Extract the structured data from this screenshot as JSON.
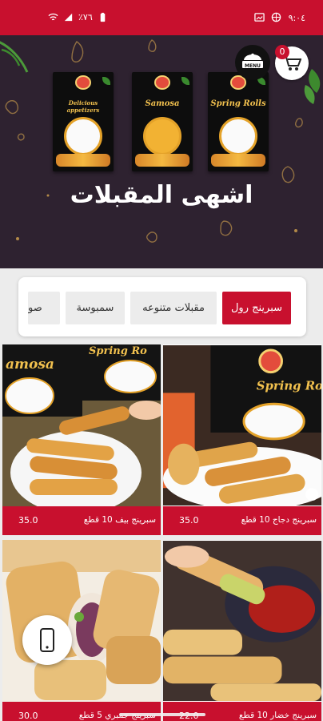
{
  "status_bar": {
    "time": "٩:٠٤",
    "battery": "٪٧٦",
    "bg_color": "#c8102e"
  },
  "hero": {
    "title": "اشهى المقبلات",
    "boxes": [
      {
        "label": "Spring Rolls"
      },
      {
        "label": "Samosa"
      },
      {
        "label": "Delicious appetizers"
      }
    ],
    "cart_count": "0",
    "menu_label": "MENU",
    "bg_color": "#2e2230"
  },
  "categories": [
    {
      "label": "سبرينج رول",
      "active": true
    },
    {
      "label": "مقبلات متنوعه",
      "active": false
    },
    {
      "label": "سمبوسة",
      "active": false
    },
    {
      "label": "صو",
      "active": false
    }
  ],
  "products": [
    {
      "name": "سبرينج دجاج 10 قطع",
      "price": "35.0"
    },
    {
      "name": "سبرينج بيف 10 قطع",
      "price": "35.0"
    },
    {
      "name": "سبرينج خضار 10 قطع",
      "price": "22.0"
    },
    {
      "name": "سبرينج جمبري 5 قطع",
      "price": "30.0"
    }
  ],
  "icons": {
    "cart": "cart-icon",
    "menu": "menu-icon",
    "phone": "phone-icon"
  },
  "accent_color": "#c8102e"
}
